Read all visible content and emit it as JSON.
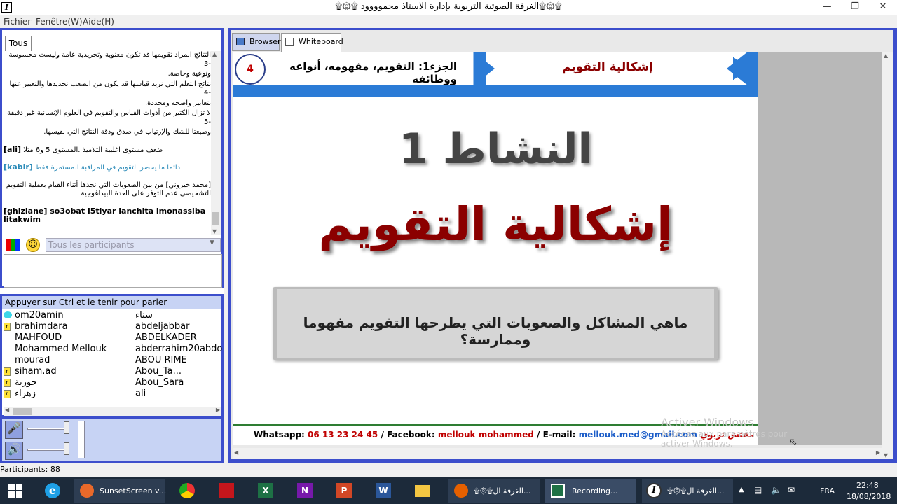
{
  "window": {
    "title": "۩۞۩الغرفة الصوتية التربوية بإدارة الاستاذ محموووود ۩۞۩",
    "icon_letter": "I"
  },
  "menu": [
    "Fichier",
    "Fenêtre(W)",
    "Aide(H)"
  ],
  "chat": {
    "tab": "Tous",
    "lines": [
      "التتائج المراد تقويمها قد تكون معنوية وتجريدية عامة وليست محسوسة -3",
      "ونوعية وخاصة.",
      "نتائج التعلم التي نريد قياسها قد يكون من الصعب تحديدها والتعبير عنها -4",
      "بتعابير واضحة ومحددة.",
      "لا تزال الكثير من أدوات القياس والتقويم في العلوم الإنسانية غير دقيقة -5",
      "وصبعثا للشك والإرتياب في صدق ودقة النتائج التي نقيسها."
    ],
    "msg1": {
      "user": "[ali]",
      "text": "ضعف مستوى اغلبية التلاميذ .المستوى 5 و6 مثلا"
    },
    "msg2": {
      "user": "[kabir]",
      "text": "دائما ما يحصر التقويم في المراقبة المستمرة فقط"
    },
    "msg3": {
      "text": "[محمد خيروني] من بين الصعوبات التي نجدها أثناء القيام بعملية التقويم التشخيصي عدم التوفر على العدة البيداغوجية"
    },
    "msg4": {
      "text": "[ghizlane] so3obat i5tiyar lanchita lmonassiba litakwim"
    },
    "recipient_placeholder": "Tous les participants"
  },
  "users": {
    "header": "Appuyer sur Ctrl et le tenir pour parler",
    "col1": [
      "om20amin",
      "brahimdara",
      "MAHFOUD",
      "Mohammed Mellouk",
      "mourad",
      "siham.ad",
      "حورية",
      "زهراء"
    ],
    "col2": [
      "سناء",
      "abdeljabbar",
      "ABDELKADER",
      "abderrahim20abdo",
      "ABOU RIME",
      "Abou_Ta...",
      "Abou_Sara",
      "ali"
    ]
  },
  "participants": "Participants: 88",
  "tabs": {
    "browser": "Browser",
    "whiteboard": "Whiteboard"
  },
  "slide": {
    "number": "4",
    "part": "الجزء1: التقويم، مفهومه، أنواعه ووظائفه",
    "section": "إشكالية التقويم",
    "activity": "النشاط 1",
    "title": "إشكالية التقويم",
    "question": "ماهي المشاكل والصعوبات التي يطرحها التقويم مفهوما وممارسة؟",
    "footer": {
      "whatsapp_label": "Whatsapp:",
      "whatsapp": "06 13 23 24 45",
      "fb_label": "/ Facebook:",
      "fb": "mellouk mohammed",
      "email_label": "/ E-mail:",
      "email": "mellouk.med@gmail.com",
      "author": "محمد ملوك مفتش تربوي"
    }
  },
  "watermark": {
    "line1": "Activer Windows",
    "line2": "Accédez aux paramètres pour",
    "line3": "activer Windows."
  },
  "taskbar": {
    "sunset": "SunsetScreen v...",
    "firefox": "۩۞۩الغرفة ال...",
    "recording": "Recording...",
    "ivocalis": "۩۞۩الغرفة ال...",
    "lang": "FRA",
    "time": "22:48",
    "date": "18/08/2018"
  },
  "colors": {
    "frame": "#3c4ecc",
    "slide_blue": "#2b7bd6",
    "dark_red": "#8b0000",
    "red": "#c00000"
  }
}
